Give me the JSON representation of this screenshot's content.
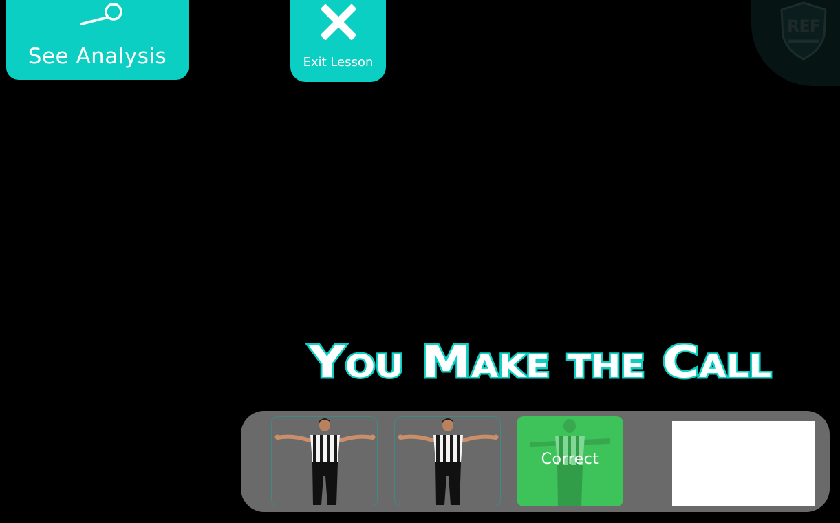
{
  "header": {
    "see_analysis": {
      "label": "See Analysis",
      "icon": "magnifier-icon"
    },
    "exit_lesson": {
      "label": "Exit Lesson",
      "icon": "close-x-icon"
    },
    "logo": {
      "text": "REF",
      "icon": "ref-shield-logo"
    }
  },
  "main": {
    "headline": "You Make the Call"
  },
  "choices": {
    "options": [
      {
        "kind": "referee-signal",
        "icon": "referee-arms-outstretched-signal",
        "state": "default"
      },
      {
        "kind": "referee-signal",
        "icon": "referee-arms-outstretched-signal",
        "state": "default"
      },
      {
        "kind": "referee-signal",
        "icon": "referee-signal-highlighted",
        "state": "selected",
        "result_label": "Correct"
      }
    ],
    "preview": {
      "kind": "video-panel"
    }
  },
  "colors": {
    "accent": "#0ccfc4",
    "correct": "#3ec25a",
    "tray": "#6a6a6a",
    "background": "#000000"
  }
}
